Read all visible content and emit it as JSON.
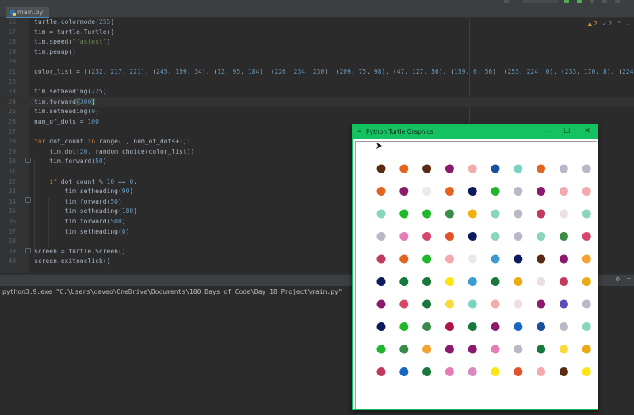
{
  "editor_tab": {
    "filename": "main.py",
    "icon": "python-file-icon"
  },
  "editor_status": {
    "warnings": "2",
    "weak_warnings": "2"
  },
  "code_lines": [
    {
      "n": "16",
      "html": "turtle.colormode(<span class='num'>255</span>)"
    },
    {
      "n": "17",
      "html": "tim = turtle.Turtle()"
    },
    {
      "n": "18",
      "html": "tim.speed(<span class='str'>\"fastest\"</span>)"
    },
    {
      "n": "19",
      "html": "tim.penup()"
    },
    {
      "n": "20",
      "html": ""
    },
    {
      "n": "21",
      "html": "color_list = [(<span class='num'>232</span>, <span class='num'>217</span>, <span class='num'>221</span>), (<span class='num'>245</span>, <span class='num'>159</span>, <span class='num'>34</span>), (<span class='num'>12</span>, <span class='num'>95</span>, <span class='num'>184</span>), (<span class='num'>226</span>, <span class='num'>234</span>, <span class='num'>230</span>), (<span class='num'>209</span>, <span class='num'>75</span>, <span class='num'>98</span>), (<span class='num'>47</span>, <span class='num'>127</span>, <span class='num'>56</span>), (<span class='num'>159</span>, <span class='num'>6</span>, <span class='num'>56</span>), (<span class='num'>253</span>, <span class='num'>224</span>, <span class='num'>0</span>), (<span class='num'>233</span>, <span class='num'>170</span>, <span class='num'>8</span>), (<span class='num'>224</span>, <span class='num'>114</span>, <span class='num'>1</span>"
    },
    {
      "n": "22",
      "html": ""
    },
    {
      "n": "23",
      "html": "tim.setheading(<span class='num'>225</span>)"
    },
    {
      "n": "24",
      "html": "tim.forward<span class='match'>(</span><span class='num'>300</span><span class='match'>)</span>",
      "current": true
    },
    {
      "n": "25",
      "html": "tim.setheading(<span class='num'>0</span>)"
    },
    {
      "n": "26",
      "html": "num_of_dots = <span class='num'>100</span>"
    },
    {
      "n": "27",
      "html": ""
    },
    {
      "n": "28",
      "html": "<span class='kw'>for</span> dot_count <span class='kw'>in</span> range(<span class='num'>1</span>, num_of_dots+<span class='num'>1</span>):"
    },
    {
      "n": "29",
      "html": "    tim.dot(<span class='num'>20</span>, random.choice(color_list))"
    },
    {
      "n": "30",
      "html": "    tim.forward(<span class='num'>50</span>)"
    },
    {
      "n": "31",
      "html": ""
    },
    {
      "n": "32",
      "html": "    <span class='kw'>if</span> dot_count % <span class='num'>10</span> == <span class='num'>0</span>:"
    },
    {
      "n": "33",
      "html": "        tim.setheading(<span class='num'>90</span>)"
    },
    {
      "n": "34",
      "html": "        tim.forward(<span class='num'>50</span>)"
    },
    {
      "n": "35",
      "html": "        tim.setheading(<span class='num'>180</span>)"
    },
    {
      "n": "36",
      "html": "        tim.forward(<span class='num'>500</span>)"
    },
    {
      "n": "37",
      "html": "        tim.setheading(<span class='num'>0</span>)"
    },
    {
      "n": "38",
      "html": ""
    },
    {
      "n": "39",
      "html": "screen = turtle.Screen()"
    },
    {
      "n": "40",
      "html": "screen.exitonclick()"
    }
  ],
  "console": {
    "command": "python3.9.exe \"C:\\Users\\daveo\\OneDrive\\Documents\\100 Days of Code\\Day 18 Project\\main.py\""
  },
  "turtle_window": {
    "title": "Python Turtle Graphics",
    "minimize": "—",
    "maximize": "☐",
    "close": "✕",
    "title_color": "#15c261",
    "dot_rows": [
      [
        "#5a2a12",
        "#e2651f",
        "#5a2a12",
        "#8b1a6a",
        "#f4a9ad",
        "#1b4fa0",
        "#78d3c3",
        "#e2651f",
        "#b7b9c6",
        "#b7b9c6"
      ],
      [
        "#e2651f",
        "#8b1a6a",
        "#e6ebe8",
        "#e2651f",
        "#0d1b5e",
        "#1eb82a",
        "#b7b9c6",
        "#8b1a6a",
        "#f4a9ad",
        "#f4a9ad"
      ],
      [
        "#89d6c0",
        "#1eb82a",
        "#1eb82a",
        "#3a8a48",
        "#f0b10e",
        "#89d6c0",
        "#b7b9c6",
        "#c13a5c",
        "#eedfe2",
        "#89d6c0"
      ],
      [
        "#b7b9c6",
        "#e67cb7",
        "#d6476a",
        "#e3522b",
        "#0d1b5e",
        "#89d6c0",
        "#b7b9c6",
        "#89d6c0",
        "#3a8a48",
        "#d6476a"
      ],
      [
        "#c13a5c",
        "#e2651f",
        "#1eb82a",
        "#f4a9ad",
        "#e6ebe8",
        "#3e9bd0",
        "#0d1b5e",
        "#5a2a12",
        "#8b1a6a",
        "#f5a230"
      ],
      [
        "#0d1b5e",
        "#16793b",
        "#16793b",
        "#fde510",
        "#3e9bd0",
        "#16793b",
        "#eaab10",
        "#eedfe2",
        "#c13a5c",
        "#eaab10"
      ],
      [
        "#8b1a6a",
        "#d6476a",
        "#16793b",
        "#fbd93d",
        "#78d3c3",
        "#f4a9ad",
        "#eedfe2",
        "#8b1a6a",
        "#5b4fbf",
        "#b7b9c6"
      ],
      [
        "#0d1b5e",
        "#1eb82a",
        "#3a8a48",
        "#b0134b",
        "#16793b",
        "#8b1a6a",
        "#1766c2",
        "#1b4fa0",
        "#b7b9c6",
        "#89d6c0"
      ],
      [
        "#1eb82a",
        "#3a8a48",
        "#f5a230",
        "#8b1a6a",
        "#8b1a6a",
        "#e67cb7",
        "#b7b9c6",
        "#16793b",
        "#fbd93d",
        "#eaab10"
      ],
      [
        "#c13a5c",
        "#1766c2",
        "#16793b",
        "#e67cb7",
        "#d88ac0",
        "#fde510",
        "#e3522b",
        "#f4a9ad",
        "#5a2a12",
        "#fde510"
      ]
    ]
  }
}
